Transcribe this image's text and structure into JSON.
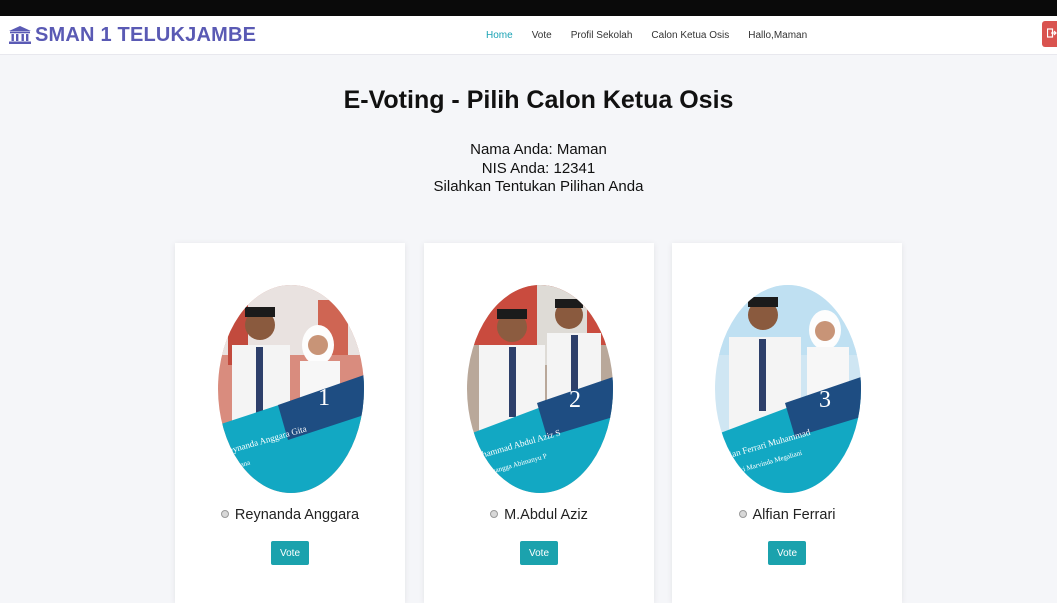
{
  "brand": {
    "name": "SMAN 1 TELUKJAMBE",
    "icon": "bank-icon"
  },
  "nav": {
    "items": [
      {
        "label": "Home",
        "active": true
      },
      {
        "label": "Vote"
      },
      {
        "label": "Profil Sekolah"
      },
      {
        "label": "Calon Ketua Osis"
      },
      {
        "label": "Hallo,Maman"
      }
    ],
    "logout_icon": "sign-out-icon"
  },
  "page": {
    "title": "E-Voting - Pilih Calon Ketua Osis",
    "nama": "Nama Anda: Maman",
    "nis": "NIS Anda: 12341",
    "instruction": "Silahkan Tentukan Pilihan Anda"
  },
  "candidates": [
    {
      "name": "Reynanda Anggara",
      "number": "1",
      "banner_line1": "Reynanda Anggara Gita",
      "banner_line2": "afiana",
      "vote_label": "Vote"
    },
    {
      "name": "M.Abdul Aziz",
      "number": "2",
      "banner_line1": "Muhammad Abdul Aziz S",
      "banner_line2": "Awangga Abimanyu P",
      "vote_label": "Vote"
    },
    {
      "name": "Alfian Ferrari",
      "number": "3",
      "banner_line1": "Alfian Ferrari Muhammad",
      "banner_line2": "Rizki Marvinda Megaliani",
      "vote_label": "Vote"
    }
  ],
  "colors": {
    "brand": "#5a5ab4",
    "accent": "#1aa3b5",
    "vote_button": "#1ba2ad",
    "logout": "#d9534f"
  }
}
